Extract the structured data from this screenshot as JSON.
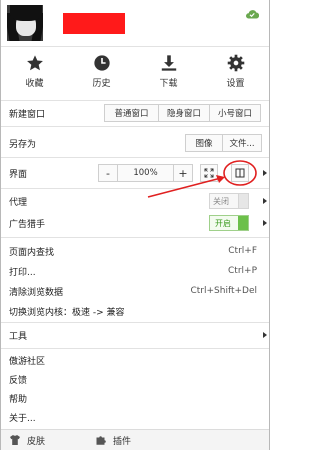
{
  "actions": [
    {
      "label": "收藏",
      "icon": "star-icon"
    },
    {
      "label": "历史",
      "icon": "clock-icon"
    },
    {
      "label": "下载",
      "icon": "download-icon"
    },
    {
      "label": "设置",
      "icon": "gear-icon"
    }
  ],
  "new_window": {
    "label": "新建窗口",
    "normal": "普通窗口",
    "incognito": "隐身窗口",
    "small": "小号窗口"
  },
  "save_as": {
    "label": "另存为",
    "image": "图像",
    "file": "文件..."
  },
  "interface": {
    "label": "界面",
    "zoom_minus": "-",
    "zoom_value": "100%",
    "zoom_plus": "+"
  },
  "proxy": {
    "label": "代理",
    "state": "关闭"
  },
  "ad_blocker": {
    "label": "广告猎手",
    "state": "开启"
  },
  "menu_items": [
    {
      "label": "页面内查找",
      "shortcut": "Ctrl+F"
    },
    {
      "label": "打印...",
      "shortcut": "Ctrl+P"
    },
    {
      "label": "清除浏览数据",
      "shortcut": "Ctrl+Shift+Del"
    },
    {
      "label": "切换浏览内核：极速 -> 兼容",
      "shortcut": ""
    }
  ],
  "tools": {
    "label": "工具"
  },
  "bottom_items": [
    {
      "label": "傲游社区"
    },
    {
      "label": "反馈"
    },
    {
      "label": "帮助"
    },
    {
      "label": "关于..."
    }
  ],
  "footer": {
    "skin": "皮肤",
    "plugins": "插件"
  },
  "colors": {
    "redaction": "#ff1a1a",
    "annotation": "#e02020",
    "toggle_on": "#6cc04a"
  }
}
